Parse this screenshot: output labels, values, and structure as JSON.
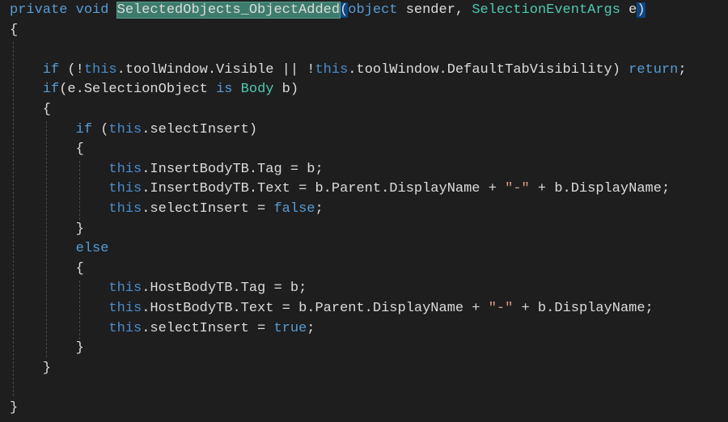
{
  "colors": {
    "background": "#1e1e1e",
    "keyword": "#569cd6",
    "type": "#4ec9b0",
    "string": "#d69d85",
    "text": "#dcdcdc",
    "selection": "#3d7c6c",
    "brace_match": "#0e4583"
  },
  "lines": [
    [
      {
        "t": "private void ",
        "c": "kw"
      },
      {
        "t": "SelectedObjects_ObjectAdded",
        "c": "sel"
      },
      {
        "t": "(",
        "c": "paren"
      },
      {
        "t": "object ",
        "c": "kw"
      },
      {
        "t": "sender, ",
        "c": "plain"
      },
      {
        "t": "SelectionEventArgs",
        "c": "type"
      },
      {
        "t": " e",
        "c": "plain"
      },
      {
        "t": ")",
        "c": "paren"
      }
    ],
    [
      {
        "t": "{",
        "c": "plain"
      }
    ],
    [],
    [
      {
        "t": "    if ",
        "c": "kw"
      },
      {
        "t": "(!",
        "c": "plain"
      },
      {
        "t": "this",
        "c": "this"
      },
      {
        "t": ".toolWindow.Visible || !",
        "c": "plain"
      },
      {
        "t": "this",
        "c": "this"
      },
      {
        "t": ".toolWindow.DefaultTabVisibility) ",
        "c": "plain"
      },
      {
        "t": "return",
        "c": "kw"
      },
      {
        "t": ";",
        "c": "plain"
      }
    ],
    [
      {
        "t": "    if",
        "c": "kw"
      },
      {
        "t": "(e.SelectionObject ",
        "c": "plain"
      },
      {
        "t": "is ",
        "c": "kw"
      },
      {
        "t": "Body",
        "c": "type"
      },
      {
        "t": " b)",
        "c": "plain"
      }
    ],
    [
      {
        "t": "    {",
        "c": "plain"
      }
    ],
    [
      {
        "t": "        if ",
        "c": "kw"
      },
      {
        "t": "(",
        "c": "plain"
      },
      {
        "t": "this",
        "c": "this"
      },
      {
        "t": ".selectInsert)",
        "c": "plain"
      }
    ],
    [
      {
        "t": "        {",
        "c": "plain"
      }
    ],
    [
      {
        "t": "            this",
        "c": "this"
      },
      {
        "t": ".InsertBodyTB.Tag = b;",
        "c": "plain"
      }
    ],
    [
      {
        "t": "            this",
        "c": "this"
      },
      {
        "t": ".InsertBodyTB.Text = b.Parent.DisplayName + ",
        "c": "plain"
      },
      {
        "t": "\"-\"",
        "c": "str"
      },
      {
        "t": " + b.DisplayName;",
        "c": "plain"
      }
    ],
    [
      {
        "t": "            this",
        "c": "this"
      },
      {
        "t": ".selectInsert = ",
        "c": "plain"
      },
      {
        "t": "false",
        "c": "kw"
      },
      {
        "t": ";",
        "c": "plain"
      }
    ],
    [
      {
        "t": "        }",
        "c": "plain"
      }
    ],
    [
      {
        "t": "        else",
        "c": "kw"
      }
    ],
    [
      {
        "t": "        {",
        "c": "plain"
      }
    ],
    [
      {
        "t": "            this",
        "c": "this"
      },
      {
        "t": ".HostBodyTB.Tag = b;",
        "c": "plain"
      }
    ],
    [
      {
        "t": "            this",
        "c": "this"
      },
      {
        "t": ".HostBodyTB.Text = b.Parent.DisplayName + ",
        "c": "plain"
      },
      {
        "t": "\"-\"",
        "c": "str"
      },
      {
        "t": " + b.DisplayName;",
        "c": "plain"
      }
    ],
    [
      {
        "t": "            this",
        "c": "this"
      },
      {
        "t": ".selectInsert = ",
        "c": "plain"
      },
      {
        "t": "true",
        "c": "kw"
      },
      {
        "t": ";",
        "c": "plain"
      }
    ],
    [
      {
        "t": "        }",
        "c": "plain"
      }
    ],
    [
      {
        "t": "    }",
        "c": "plain"
      }
    ],
    [],
    [
      {
        "t": "}",
        "c": "plain"
      }
    ]
  ]
}
